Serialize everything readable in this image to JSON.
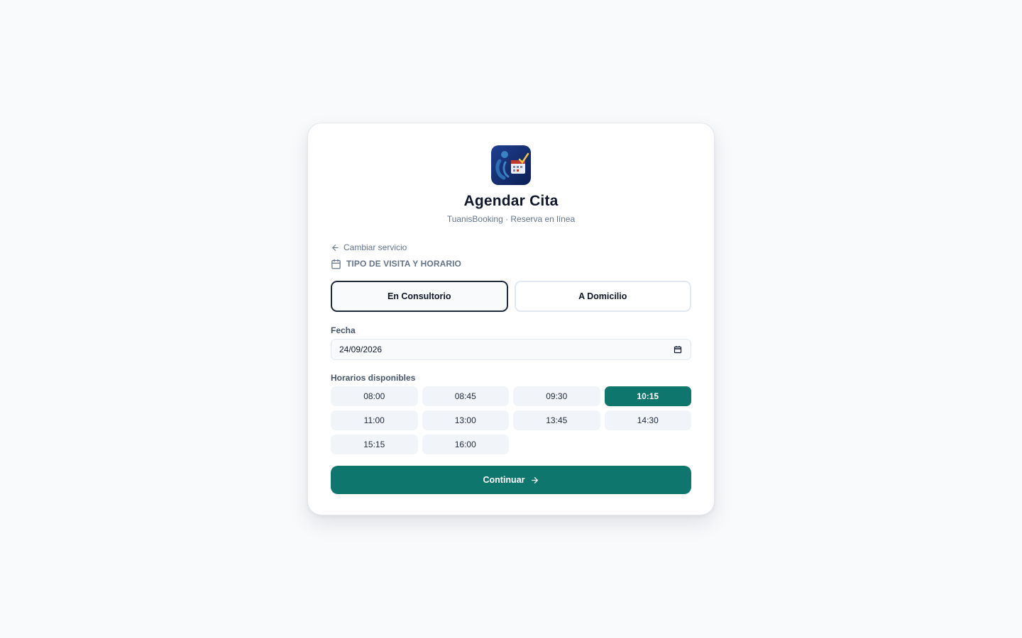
{
  "brand": {
    "logo_icon": "booking-app-logo-icon",
    "title": "Agendar Cita",
    "subtitle": "TuanisBooking · Reserva en línea"
  },
  "nav": {
    "back_label": "Cambiar servicio",
    "back_icon": "arrow-left-icon"
  },
  "section": {
    "icon": "calendar-icon",
    "title": "TIPO DE VISITA Y HORARIO"
  },
  "visit_types": [
    {
      "label": "En Consultorio",
      "selected": true
    },
    {
      "label": "A Domicilio",
      "selected": false
    }
  ],
  "date_field": {
    "label": "Fecha",
    "value": "24/09/2026",
    "icon": "calendar-picker-icon"
  },
  "slots": {
    "label": "Horarios disponibles",
    "times": [
      "08:00",
      "08:45",
      "09:30",
      "10:15",
      "11:00",
      "13:00",
      "13:45",
      "14:30",
      "15:15",
      "16:00"
    ],
    "selected": "10:15"
  },
  "actions": {
    "continue_label": "Continuar",
    "continue_icon": "arrow-right-icon"
  },
  "colors": {
    "accent": "#0f766e",
    "text": "#0f172a",
    "muted": "#64748b",
    "background": "#f8fafc"
  }
}
